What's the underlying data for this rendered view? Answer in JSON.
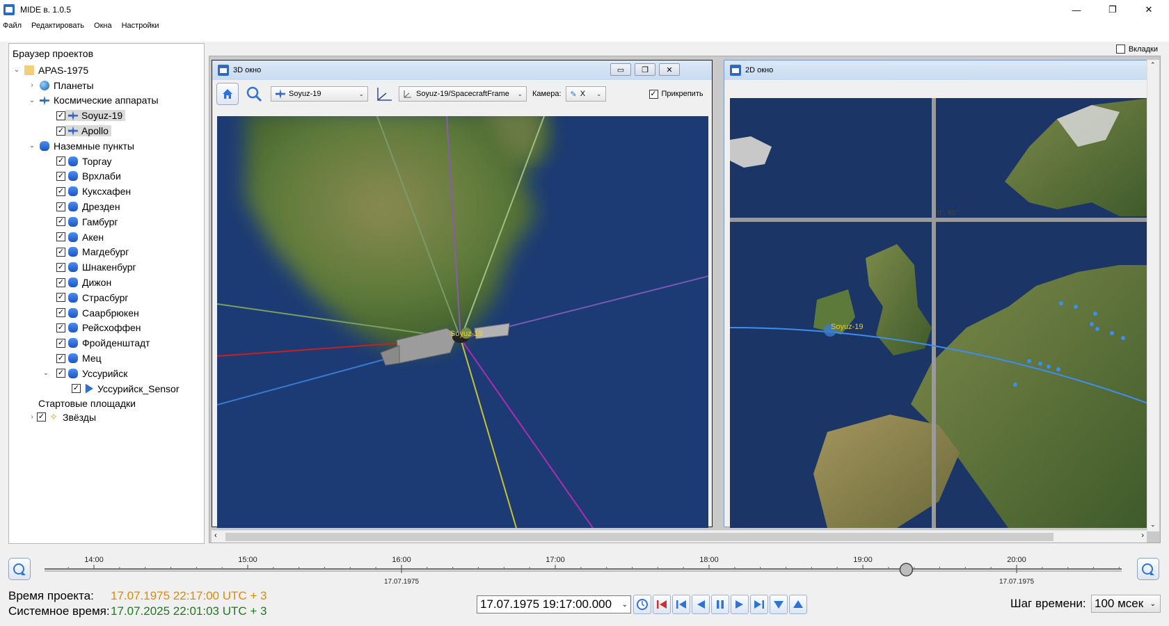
{
  "window": {
    "title": "MIDE в. 1.0.5",
    "minimize": "—",
    "maximize": "❐",
    "close": "✕"
  },
  "menu": [
    "Файл",
    "Редактировать",
    "Окна",
    "Настройки"
  ],
  "tabs_toggle": {
    "label": "Вкладки",
    "checked": false
  },
  "browser": {
    "title": "Браузер проектов",
    "project": "APAS-1975",
    "planets": "Планеты",
    "spacecraft_group": "Космические аппараты",
    "spacecraft": [
      "Soyuz-19",
      "Apollo"
    ],
    "ground_group": "Наземные пункты",
    "ground_stations": [
      "Торгау",
      "Врхлаби",
      "Куксхафен",
      "Дрезден",
      "Гамбург",
      "Акен",
      "Магдебург",
      "Шнакенбург",
      "Дижон",
      "Страсбург",
      "Саарбрюкен",
      "Рейсхоффен",
      "Фройденштадт",
      "Мец",
      "Уссурийск"
    ],
    "sensor": "Уссурийск_Sensor",
    "launch_pads": "Стартовые площадки",
    "stars": "Звёзды"
  },
  "win3d": {
    "title": "3D окно",
    "object_combo": "Soyuz-19",
    "frame_combo": "Soyuz-19/SpacecraftFrame",
    "camera_label": "Камера:",
    "camera_combo": "X",
    "attach_label": "Прикрепить",
    "attach_checked": true,
    "sc_label": "Soyuz-19"
  },
  "win2d": {
    "title": "2D окно",
    "sc_label": "Soyuz-19",
    "grid_label": "0°, 60°"
  },
  "timeline": {
    "ticks": [
      "14:00",
      "15:00",
      "16:00",
      "17:00",
      "18:00",
      "19:00",
      "20:00"
    ],
    "dates": [
      "17.07.1975",
      "17.07.1975"
    ],
    "cursor_fraction": 0.8
  },
  "status": {
    "project_time_label": "Время проекта:",
    "project_time": "17.07.1975 22:17:00 UTC + 3",
    "system_time_label": "Системное время:",
    "system_time": "17.07.2025 22:01:03 UTC + 3",
    "current_datetime": "17.07.1975 19:17:00.000",
    "step_label": "Шаг времени:",
    "step_value": "100 мсек"
  },
  "colors": {
    "project_time": "#e08a00",
    "system_time": "#1f7a1f",
    "earth_ocean": "#1c3b74"
  }
}
